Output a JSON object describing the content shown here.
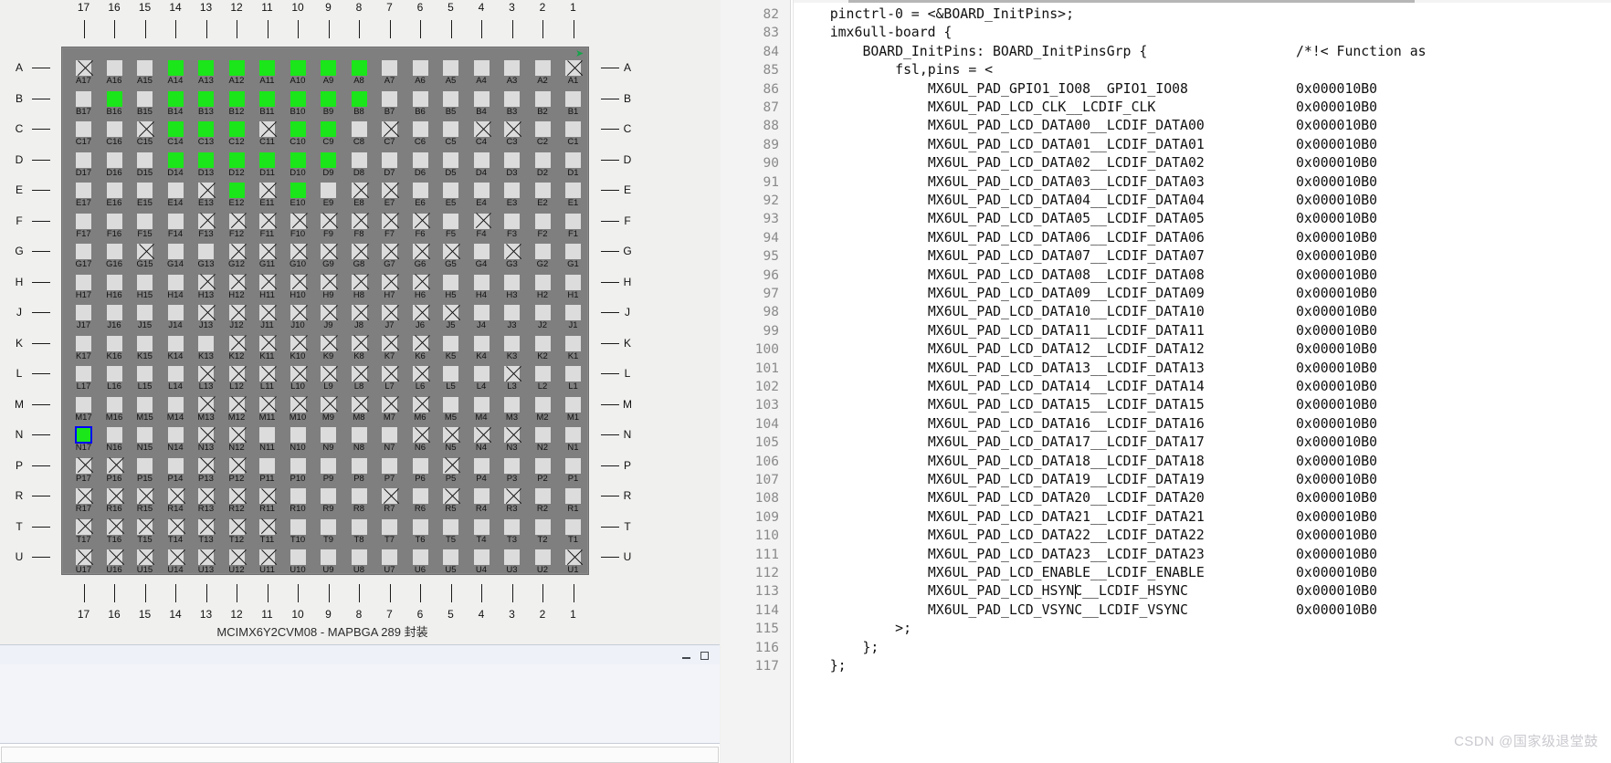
{
  "package_view": {
    "caption": "MCIMX6Y2CVM08 - MAPBGA 289 封装",
    "columns": [
      "17",
      "16",
      "15",
      "14",
      "13",
      "12",
      "11",
      "10",
      "9",
      "8",
      "7",
      "6",
      "5",
      "4",
      "3",
      "2",
      "1"
    ],
    "rows": [
      "A",
      "B",
      "C",
      "D",
      "E",
      "F",
      "G",
      "H",
      "J",
      "K",
      "L",
      "M",
      "N",
      "P",
      "R",
      "T",
      "U"
    ],
    "corner_tag_icon": "green-arrow-icon",
    "legend_colors": {
      "routed": "#1ae61a",
      "free": "#dcdcdc",
      "unavailable": "#dcdcdc",
      "selected_outline": "#0000ff",
      "package_body": "#807f7f"
    },
    "selected_pin": "N17",
    "pin_states": {
      "A": [
        "na",
        "free",
        "free",
        "used",
        "used",
        "used",
        "used",
        "used",
        "used",
        "used",
        "free",
        "free",
        "free",
        "free",
        "free",
        "free",
        "na"
      ],
      "B": [
        "free",
        "used",
        "free",
        "used",
        "used",
        "used",
        "used",
        "used",
        "used",
        "used",
        "free",
        "free",
        "free",
        "free",
        "free",
        "free",
        "free"
      ],
      "C": [
        "free",
        "free",
        "na",
        "used",
        "used",
        "used",
        "na",
        "used",
        "used",
        "free",
        "na",
        "free",
        "free",
        "na",
        "na",
        "free",
        "free"
      ],
      "D": [
        "free",
        "free",
        "free",
        "used",
        "used",
        "used",
        "used",
        "used",
        "used",
        "free",
        "free",
        "free",
        "free",
        "free",
        "free",
        "free",
        "free"
      ],
      "E": [
        "free",
        "free",
        "free",
        "free",
        "na",
        "used",
        "na",
        "used",
        "free",
        "na",
        "na",
        "free",
        "free",
        "free",
        "free",
        "free",
        "free"
      ],
      "F": [
        "free",
        "free",
        "free",
        "free",
        "na",
        "na",
        "na",
        "na",
        "na",
        "na",
        "na",
        "na",
        "free",
        "na",
        "free",
        "free",
        "free"
      ],
      "G": [
        "free",
        "free",
        "na",
        "free",
        "free",
        "na",
        "na",
        "na",
        "na",
        "na",
        "na",
        "na",
        "na",
        "free",
        "na",
        "free",
        "free"
      ],
      "H": [
        "free",
        "free",
        "free",
        "free",
        "na",
        "na",
        "na",
        "na",
        "na",
        "na",
        "na",
        "na",
        "free",
        "free",
        "free",
        "free",
        "free"
      ],
      "J": [
        "free",
        "free",
        "free",
        "free",
        "na",
        "na",
        "na",
        "na",
        "na",
        "na",
        "na",
        "na",
        "na",
        "free",
        "free",
        "free",
        "free"
      ],
      "K": [
        "free",
        "free",
        "free",
        "free",
        "free",
        "na",
        "na",
        "na",
        "na",
        "na",
        "na",
        "na",
        "free",
        "free",
        "free",
        "free",
        "free"
      ],
      "L": [
        "free",
        "free",
        "free",
        "free",
        "na",
        "na",
        "na",
        "na",
        "na",
        "na",
        "na",
        "na",
        "free",
        "free",
        "na",
        "free",
        "free"
      ],
      "M": [
        "free",
        "free",
        "free",
        "free",
        "na",
        "na",
        "na",
        "na",
        "na",
        "na",
        "na",
        "na",
        "free",
        "free",
        "free",
        "free",
        "free"
      ],
      "N": [
        "sel",
        "free",
        "free",
        "free",
        "na",
        "na",
        "free",
        "free",
        "free",
        "free",
        "free",
        "na",
        "na",
        "na",
        "na",
        "free",
        "free"
      ],
      "P": [
        "na",
        "na",
        "free",
        "free",
        "na",
        "na",
        "free",
        "free",
        "free",
        "free",
        "free",
        "free",
        "na",
        "free",
        "free",
        "free",
        "free"
      ],
      "R": [
        "na",
        "na",
        "na",
        "na",
        "na",
        "na",
        "na",
        "free",
        "free",
        "free",
        "na",
        "free",
        "na",
        "free",
        "na",
        "free",
        "free"
      ],
      "T": [
        "na",
        "na",
        "na",
        "na",
        "na",
        "na",
        "na",
        "free",
        "free",
        "free",
        "free",
        "free",
        "free",
        "free",
        "free",
        "free",
        "free"
      ],
      "U": [
        "na",
        "na",
        "na",
        "na",
        "na",
        "na",
        "na",
        "free",
        "free",
        "free",
        "free",
        "free",
        "free",
        "free",
        "free",
        "free",
        "na"
      ]
    }
  },
  "mini_window": {
    "minimize_icon": "minimize-icon",
    "maximize_icon": "maximize-icon"
  },
  "editor": {
    "lines": [
      {
        "n": "82",
        "indent": 4,
        "text": "pinctrl-0 = <&BOARD_InitPins>;",
        "comment": ""
      },
      {
        "n": "83",
        "indent": 4,
        "text": "imx6ull-board {",
        "comment": ""
      },
      {
        "n": "84",
        "indent": 8,
        "text": "BOARD_InitPins: BOARD_InitPinsGrp {",
        "comment": "/*!< Function as"
      },
      {
        "n": "85",
        "indent": 12,
        "text": "fsl,pins = <",
        "comment": ""
      },
      {
        "n": "86",
        "indent": 16,
        "text": "MX6UL_PAD_GPIO1_IO08__GPIO1_IO08",
        "value": "0x000010B0"
      },
      {
        "n": "87",
        "indent": 16,
        "text": "MX6UL_PAD_LCD_CLK__LCDIF_CLK",
        "value": "0x000010B0"
      },
      {
        "n": "88",
        "indent": 16,
        "text": "MX6UL_PAD_LCD_DATA00__LCDIF_DATA00",
        "value": "0x000010B0"
      },
      {
        "n": "89",
        "indent": 16,
        "text": "MX6UL_PAD_LCD_DATA01__LCDIF_DATA01",
        "value": "0x000010B0"
      },
      {
        "n": "90",
        "indent": 16,
        "text": "MX6UL_PAD_LCD_DATA02__LCDIF_DATA02",
        "value": "0x000010B0"
      },
      {
        "n": "91",
        "indent": 16,
        "text": "MX6UL_PAD_LCD_DATA03__LCDIF_DATA03",
        "value": "0x000010B0"
      },
      {
        "n": "92",
        "indent": 16,
        "text": "MX6UL_PAD_LCD_DATA04__LCDIF_DATA04",
        "value": "0x000010B0"
      },
      {
        "n": "93",
        "indent": 16,
        "text": "MX6UL_PAD_LCD_DATA05__LCDIF_DATA05",
        "value": "0x000010B0"
      },
      {
        "n": "94",
        "indent": 16,
        "text": "MX6UL_PAD_LCD_DATA06__LCDIF_DATA06",
        "value": "0x000010B0"
      },
      {
        "n": "95",
        "indent": 16,
        "text": "MX6UL_PAD_LCD_DATA07__LCDIF_DATA07",
        "value": "0x000010B0"
      },
      {
        "n": "96",
        "indent": 16,
        "text": "MX6UL_PAD_LCD_DATA08__LCDIF_DATA08",
        "value": "0x000010B0"
      },
      {
        "n": "97",
        "indent": 16,
        "text": "MX6UL_PAD_LCD_DATA09__LCDIF_DATA09",
        "value": "0x000010B0"
      },
      {
        "n": "98",
        "indent": 16,
        "text": "MX6UL_PAD_LCD_DATA10__LCDIF_DATA10",
        "value": "0x000010B0"
      },
      {
        "n": "99",
        "indent": 16,
        "text": "MX6UL_PAD_LCD_DATA11__LCDIF_DATA11",
        "value": "0x000010B0"
      },
      {
        "n": "100",
        "indent": 16,
        "text": "MX6UL_PAD_LCD_DATA12__LCDIF_DATA12",
        "value": "0x000010B0"
      },
      {
        "n": "101",
        "indent": 16,
        "text": "MX6UL_PAD_LCD_DATA13__LCDIF_DATA13",
        "value": "0x000010B0"
      },
      {
        "n": "102",
        "indent": 16,
        "text": "MX6UL_PAD_LCD_DATA14__LCDIF_DATA14",
        "value": "0x000010B0"
      },
      {
        "n": "103",
        "indent": 16,
        "text": "MX6UL_PAD_LCD_DATA15__LCDIF_DATA15",
        "value": "0x000010B0"
      },
      {
        "n": "104",
        "indent": 16,
        "text": "MX6UL_PAD_LCD_DATA16__LCDIF_DATA16",
        "value": "0x000010B0"
      },
      {
        "n": "105",
        "indent": 16,
        "text": "MX6UL_PAD_LCD_DATA17__LCDIF_DATA17",
        "value": "0x000010B0"
      },
      {
        "n": "106",
        "indent": 16,
        "text": "MX6UL_PAD_LCD_DATA18__LCDIF_DATA18",
        "value": "0x000010B0"
      },
      {
        "n": "107",
        "indent": 16,
        "text": "MX6UL_PAD_LCD_DATA19__LCDIF_DATA19",
        "value": "0x000010B0"
      },
      {
        "n": "108",
        "indent": 16,
        "text": "MX6UL_PAD_LCD_DATA20__LCDIF_DATA20",
        "value": "0x000010B0"
      },
      {
        "n": "109",
        "indent": 16,
        "text": "MX6UL_PAD_LCD_DATA21__LCDIF_DATA21",
        "value": "0x000010B0"
      },
      {
        "n": "110",
        "indent": 16,
        "text": "MX6UL_PAD_LCD_DATA22__LCDIF_DATA22",
        "value": "0x000010B0"
      },
      {
        "n": "111",
        "indent": 16,
        "text": "MX6UL_PAD_LCD_DATA23__LCDIF_DATA23",
        "value": "0x000010B0"
      },
      {
        "n": "112",
        "indent": 16,
        "text": "MX6UL_PAD_LCD_ENABLE__LCDIF_ENABLE",
        "value": "0x000010B0"
      },
      {
        "n": "113",
        "indent": 16,
        "text": "MX6UL_PAD_LCD_HSYNC__LCDIF_HSYNC",
        "value": "0x000010B0",
        "caret_after": 18
      },
      {
        "n": "114",
        "indent": 16,
        "text": "MX6UL_PAD_LCD_VSYNC__LCDIF_VSYNC",
        "value": "0x000010B0"
      },
      {
        "n": "115",
        "indent": 12,
        "text": ">;",
        "value": ""
      },
      {
        "n": "116",
        "indent": 8,
        "text": "};",
        "value": ""
      },
      {
        "n": "117",
        "indent": 4,
        "text": "};",
        "value": ""
      }
    ]
  },
  "watermark": {
    "text": "CSDN @国家级退堂鼓"
  }
}
